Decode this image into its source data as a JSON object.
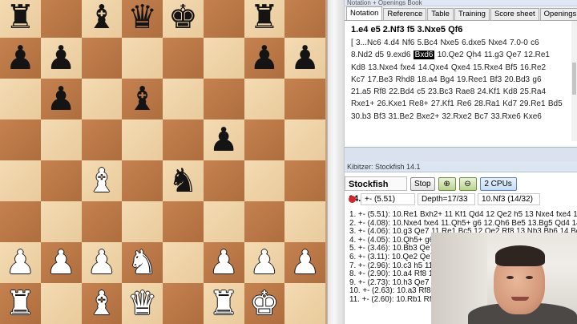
{
  "board": {
    "ranks": [
      [
        "bR",
        "",
        "bB",
        "bQ",
        "bK",
        "",
        "bR",
        ""
      ],
      [
        "bP",
        "bP",
        "",
        "",
        "",
        "",
        "bP",
        "bP"
      ],
      [
        "",
        "bP",
        "",
        "bB",
        "",
        "",
        "",
        ""
      ],
      [
        "",
        "",
        "",
        "",
        "",
        "bP",
        "",
        ""
      ],
      [
        "",
        "",
        "wB",
        "",
        "bN",
        "",
        "",
        ""
      ],
      [
        "",
        "",
        "",
        "",
        "",
        "",
        "",
        ""
      ],
      [
        "wP",
        "wP",
        "wP",
        "wN",
        "",
        "wP",
        "wP",
        "wP"
      ],
      [
        "wR",
        "",
        "wB",
        "wQ",
        "",
        "wR",
        "wK",
        ""
      ]
    ],
    "glyphs": {
      "K": "♚",
      "Q": "♛",
      "R": "♜",
      "B": "♝",
      "N": "♞",
      "P": "♟"
    }
  },
  "panel": {
    "window_title": "Notation + Openings Book",
    "tabs": [
      "Notation",
      "Reference",
      "Table",
      "Training",
      "Score sheet",
      "Openings Book"
    ],
    "opening": "1.e4   e5  2.Nf3  f5  3.Nxe5  Qf6",
    "moves": [
      "[ 3...Nc6  4.d4  Nf6  5.Bc4  Nxe5  6.dxe5  Nxe4  7.0-0  c6",
      "8.Nd2  d5  9.exd6",
      "Bxd6",
      "10.Qe2  Qh4  11.g3  Qe7  12.Re1",
      "Kd8  13.Nxe4  fxe4  14.Qxe4  Qxe4  15.Rxe4  Bf5  16.Re2",
      "Kc7  17.Be3  Rhd8  18.a4  Bg4  19.Ree1  Bf3  20.Bd3  g6",
      "21.a5  Rf8  22.Bd4  c5  23.Bc3  Rae8  24.Kf1  Kd8  25.Ra4",
      "Rxe1+  26.Kxe1  Re8+  27.Kf1  Re6  28.Ra1  Kd7  29.Re1  Bd5",
      "30.b3  Bf3  31.Be2  Bxe2+  32.Rxe2  Bc7  33.Rxe6  Kxe6"
    ]
  },
  "kibitzer": {
    "title": "Kibitzer: Stockfish 14.1",
    "engine": "Stockfish 14.1",
    "stop_label": "Stop",
    "cpu_label": "2 CPUs",
    "eval": "+-   (5.51)",
    "depth": "Depth=17/33",
    "current_move": "10.Nf3 (14/32)",
    "lines": [
      "1.  +-  (5.51): 10.Re1 Bxh2+ 11 Kf1 Qd4 12 Qe2 h5 13 Nxe4 fxe4 14.Qxe4",
      "2.  +-  (4.08): 10.Nxe4 fxe4 11.Qh5+ g6 12.Qh6 Be5 13.Bg5 Qd4 14.Be3",
      "3.  +-  (4.06): 10.g3 Qe7 11.Re1 Bc5 12.Qe2 Rf8 13.Nb3 Bb6 14.Be3",
      "4.  +-  (4.05): 10.Qh5+ g6",
      "5.  +-  (3.46): 10.Bb3 Qe7",
      "6.  +-  (3.11): 10.Qe2 Qe7",
      "7.  +-  (2.96): 10.c3 h5 11",
      "8.  +-  (2.90): 10.a4 Rf8 1",
      "9.  +-  (2.73): 10.h3 Qe7",
      "10. +-  (2.63): 10.a3 Rf8 1",
      "11. +-  (2.60): 10.Rb1 Rf8"
    ]
  }
}
